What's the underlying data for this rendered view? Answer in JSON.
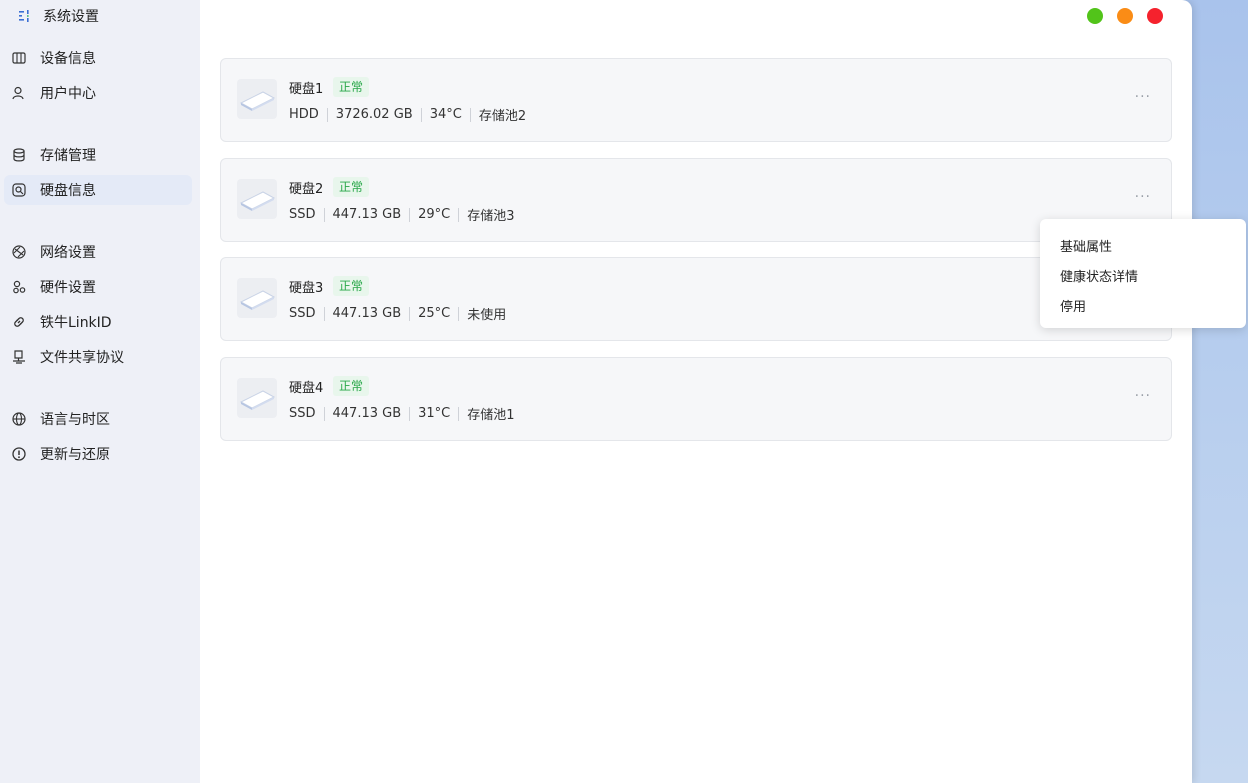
{
  "app": {
    "title": "系统设置"
  },
  "sidebar": {
    "items": [
      {
        "label": "设备信息",
        "icon": "device-info-icon"
      },
      {
        "label": "用户中心",
        "icon": "user-icon"
      },
      {
        "label": "存储管理",
        "icon": "database-icon"
      },
      {
        "label": "硬盘信息",
        "icon": "disk-search-icon",
        "active": true
      },
      {
        "label": "网络设置",
        "icon": "network-icon"
      },
      {
        "label": "硬件设置",
        "icon": "hardware-icon"
      },
      {
        "label": "铁牛LinkID",
        "icon": "link-icon"
      },
      {
        "label": "文件共享协议",
        "icon": "share-icon"
      },
      {
        "label": "语言与时区",
        "icon": "globe-icon"
      },
      {
        "label": "更新与还原",
        "icon": "update-icon"
      }
    ]
  },
  "window_controls": {
    "colors": [
      "#52c41a",
      "#fa8c16",
      "#f5222d"
    ]
  },
  "disks": [
    {
      "name": "硬盘1",
      "status": "正常",
      "type": "HDD",
      "capacity": "3726.02 GB",
      "temp": "34°C",
      "pool": "存储池2"
    },
    {
      "name": "硬盘2",
      "status": "正常",
      "type": "SSD",
      "capacity": "447.13 GB",
      "temp": "29°C",
      "pool": "存储池3"
    },
    {
      "name": "硬盘3",
      "status": "正常",
      "type": "SSD",
      "capacity": "447.13 GB",
      "temp": "25°C",
      "pool": "未使用"
    },
    {
      "name": "硬盘4",
      "status": "正常",
      "type": "SSD",
      "capacity": "447.13 GB",
      "temp": "31°C",
      "pool": "存储池1"
    }
  ],
  "more_label": "···",
  "context_menu": {
    "items": [
      "基础属性",
      "健康状态详情",
      "停用"
    ]
  }
}
